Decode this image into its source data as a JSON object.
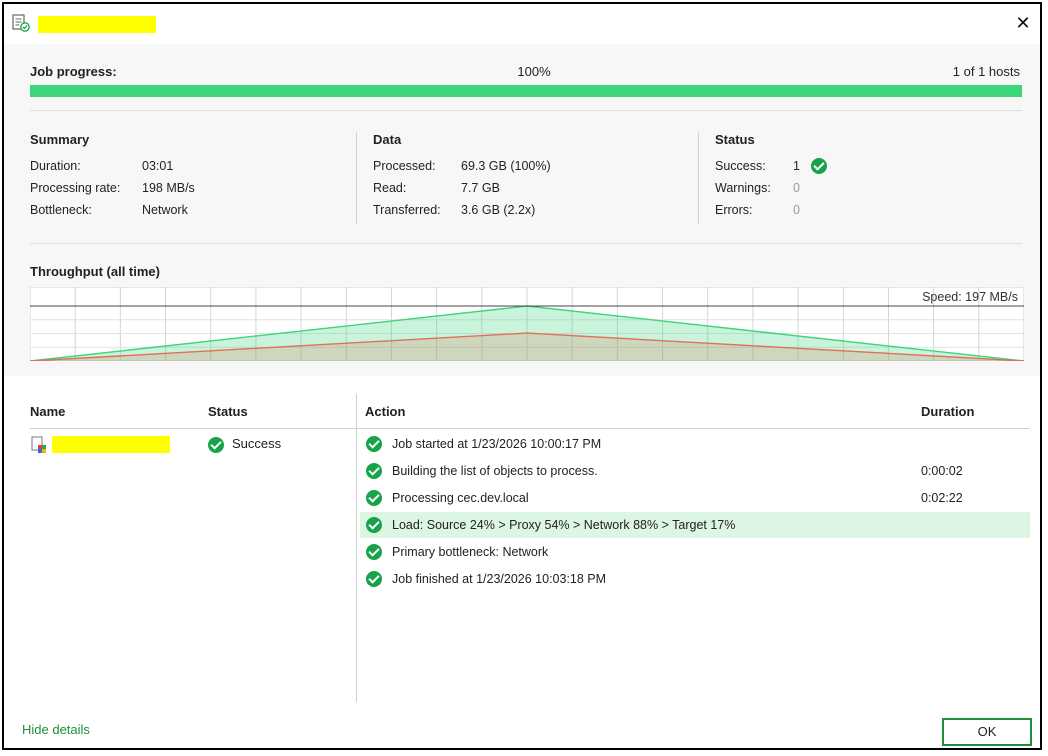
{
  "window": {
    "title": ""
  },
  "progress": {
    "label": "Job progress:",
    "percent_text": "100%",
    "hosts_text": "1 of 1 hosts",
    "fraction": 1.0
  },
  "summary": {
    "heading": "Summary",
    "rows": [
      {
        "key": "Duration:",
        "value": "03:01"
      },
      {
        "key": "Processing rate:",
        "value": "198 MB/s"
      },
      {
        "key": "Bottleneck:",
        "value": "Network"
      }
    ]
  },
  "data_section": {
    "heading": "Data",
    "rows": [
      {
        "key": "Processed:",
        "value": "69.3 GB (100%)"
      },
      {
        "key": "Read:",
        "value": "7.7 GB"
      },
      {
        "key": "Transferred:",
        "value": "3.6 GB (2.2x)"
      }
    ]
  },
  "status_section": {
    "heading": "Status",
    "rows": [
      {
        "key": "Success:",
        "value": "1"
      },
      {
        "key": "Warnings:",
        "value": "0"
      },
      {
        "key": "Errors:",
        "value": "0"
      }
    ]
  },
  "throughput": {
    "label": "Throughput (all time)",
    "speed_text": "Speed: 197 MB/s"
  },
  "chart_data": {
    "type": "area",
    "x": [
      0,
      0.5,
      1
    ],
    "series": [
      {
        "values": [
          0,
          197,
          0
        ],
        "color": "#3dd57a"
      },
      {
        "values": [
          0,
          100,
          0
        ],
        "color": "#e0705a"
      }
    ],
    "ylim": [
      0,
      197
    ],
    "grid": true
  },
  "table": {
    "headers": {
      "name": "Name",
      "status": "Status",
      "action": "Action",
      "duration": "Duration"
    },
    "object": {
      "name": "",
      "status": "Success"
    },
    "actions": [
      {
        "text": "Job started at 1/23/2026 10:00:17 PM",
        "duration": ""
      },
      {
        "text": "Building the list of objects to process.",
        "duration": "0:00:02"
      },
      {
        "text": "Processing cec.dev.local",
        "duration": "0:02:22"
      },
      {
        "text": "Load: Source 24% > Proxy 54% > Network 88% > Target 17%",
        "duration": ""
      },
      {
        "text": "Primary bottleneck: Network",
        "duration": ""
      },
      {
        "text": "Job finished at 1/23/2026 10:03:18 PM",
        "duration": ""
      }
    ]
  },
  "footer": {
    "hide_details": "Hide details",
    "ok": "OK"
  },
  "colors": {
    "accent": "#3dd57a",
    "success": "#16a34a",
    "link": "#1f8f3a",
    "highlight_row": "#dcf6e3"
  }
}
